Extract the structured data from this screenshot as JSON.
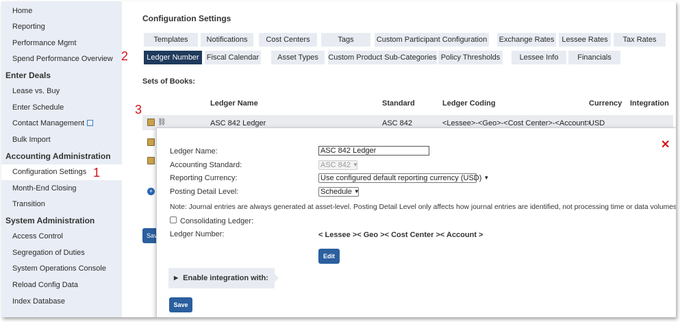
{
  "sidebar": {
    "items": [
      {
        "label": "Home",
        "type": "item"
      },
      {
        "label": "Reporting",
        "type": "item"
      },
      {
        "label": "Performance Mgmt",
        "type": "item"
      },
      {
        "label": "Spend Performance Overview",
        "type": "item"
      },
      {
        "label": "Enter Deals",
        "type": "section"
      },
      {
        "label": "Lease vs. Buy",
        "type": "item"
      },
      {
        "label": "Enter Schedule",
        "type": "item"
      },
      {
        "label": "Contact Management",
        "type": "item",
        "icon": "external-link-icon"
      },
      {
        "label": "Bulk Import",
        "type": "item"
      },
      {
        "label": "Accounting Administration",
        "type": "section"
      },
      {
        "label": "Configuration Settings",
        "type": "item",
        "active": true
      },
      {
        "label": "Month-End Closing",
        "type": "item"
      },
      {
        "label": "Transition",
        "type": "item"
      },
      {
        "label": "System Administration",
        "type": "section"
      },
      {
        "label": "Access Control",
        "type": "item"
      },
      {
        "label": "Segregation of Duties",
        "type": "item"
      },
      {
        "label": "System Operations Console",
        "type": "item"
      },
      {
        "label": "Reload Config Data",
        "type": "item"
      },
      {
        "label": "Index Database",
        "type": "item"
      }
    ]
  },
  "annotations": {
    "step1": "1",
    "step2": "2",
    "step3": "3"
  },
  "page": {
    "title": "Configuration Settings"
  },
  "tabs_row1": [
    "Templates",
    "Notifications",
    "Cost Centers",
    "Tags",
    "Custom Participant Configuration",
    "Exchange Rates",
    "Lessee Rates",
    "Tax Rates"
  ],
  "tabs_row2": [
    "Ledger Number",
    "Fiscal Calendar",
    "Asset Types",
    "Custom Product Sub-Categories",
    "Policy Thresholds",
    "Lessee Info",
    "Financials"
  ],
  "active_tab": "Ledger Number",
  "books": {
    "heading": "Sets of Books:",
    "columns": {
      "name": "Ledger Name",
      "standard": "Standard",
      "coding": "Ledger Coding",
      "currency": "Currency",
      "integration": "Integration"
    },
    "rows": [
      {
        "name": "ASC 842 Ledger",
        "standard": "ASC 842",
        "coding": "<Lessee>-<Geo>-<Cost Center>-<Account>",
        "currency": "USD"
      }
    ],
    "save_label_partial": "Sav"
  },
  "modal": {
    "ledger_name_label": "Ledger Name:",
    "ledger_name_value": "ASC 842 Ledger",
    "standard_label": "Accounting Standard:",
    "standard_value": "ASC 842",
    "currency_label": "Reporting Currency:",
    "currency_value": "Use configured default reporting currency (USD)",
    "detail_label": "Posting Detail Level:",
    "detail_value": "Schedule",
    "note": "Note: Journal entries are always generated at asset-level. Posting Detail Level only affects how journal entries are identified, not processing time or data volumes.",
    "consolidating_label": "Consolidating Ledger:",
    "ledger_number_label": "Ledger Number:",
    "ledger_number_value": "< Lessee >< Geo >< Cost Center >< Account >",
    "edit_label": "Edit",
    "enable_label": "Enable integration with:",
    "save_label": "Save",
    "close_symbol": "✕"
  },
  "colors": {
    "active_tab": "#1f3a5c",
    "button": "#2b5f9e",
    "annotation": "#d0131b",
    "sidebar_bg": "#e9edf5"
  }
}
